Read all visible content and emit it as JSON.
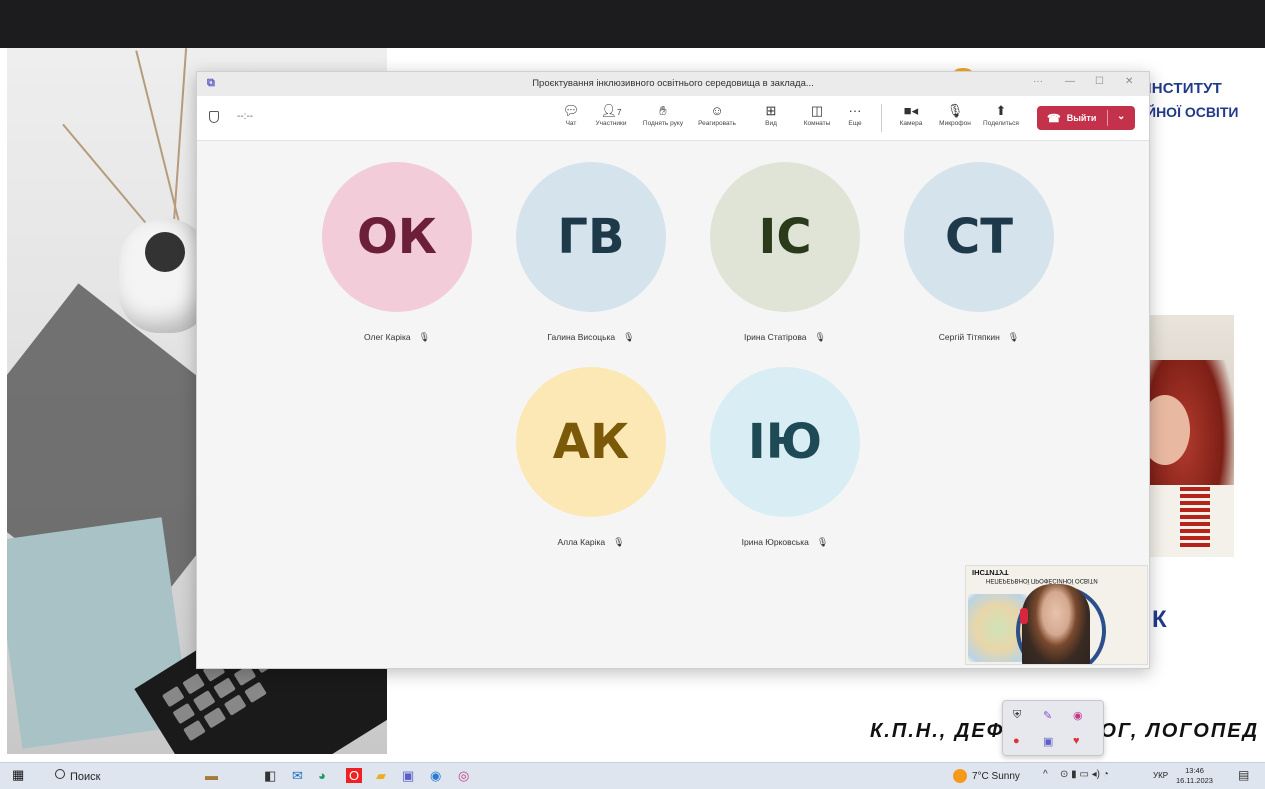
{
  "teams": {
    "window_title": "Проєктування інклюзивного освітнього середовища в заклада...",
    "timer": "--:--",
    "participants_count": "7",
    "toolbar": {
      "chat": "Чат",
      "participants": "Участники",
      "raise_hand": "Поднять руку",
      "react": "Реагировать",
      "view": "Вид",
      "rooms": "Комнаты",
      "more": "Еще",
      "camera": "Камера",
      "mic": "Микрофон",
      "share": "Поделиться",
      "leave": "Выйти"
    },
    "participants": [
      {
        "initials": "ОК",
        "name": "Олег Каріка",
        "bg": "#f2ccd9",
        "fg": "#6b1f38"
      },
      {
        "initials": "ГВ",
        "name": "Галина Висоцька",
        "bg": "#d5e3ec",
        "fg": "#1e3a4a"
      },
      {
        "initials": "ІС",
        "name": "Ірина Статірова",
        "bg": "#dfe4d7",
        "fg": "#2a3a1a"
      },
      {
        "initials": "СТ",
        "name": "Сергій Тітяпкин",
        "bg": "#d5e3ec",
        "fg": "#1e3a4a"
      },
      {
        "initials": "АК",
        "name": "Алла Каріка",
        "bg": "#fce8b5",
        "fg": "#7a5a08"
      },
      {
        "initials": "ІЮ",
        "name": "Ірина Юрковська",
        "bg": "#d8eef4",
        "fg": "#1e4a55"
      }
    ]
  },
  "slide": {
    "institute_line1": "Й ІНСТИТУТ",
    "institute_line2": "СІЙНОЇ ОСВІТИ",
    "letter_k": "К",
    "subtitle_left": "К.П.Н., ДЕФ",
    "subtitle_right": "ОГ, ЛОГОПЕД"
  },
  "selfview": {
    "slide_title": "ІНСТИТУТ",
    "slide_subtitle": "НЕПЕРЕРВНОЇ ПРОФЕСІЙНОЇ ОСВІТИ"
  },
  "taskbar": {
    "search": "Поиск",
    "weather": "7°C Sunny",
    "language": "УКР",
    "time": "13:46",
    "date": "16.11.2023"
  }
}
